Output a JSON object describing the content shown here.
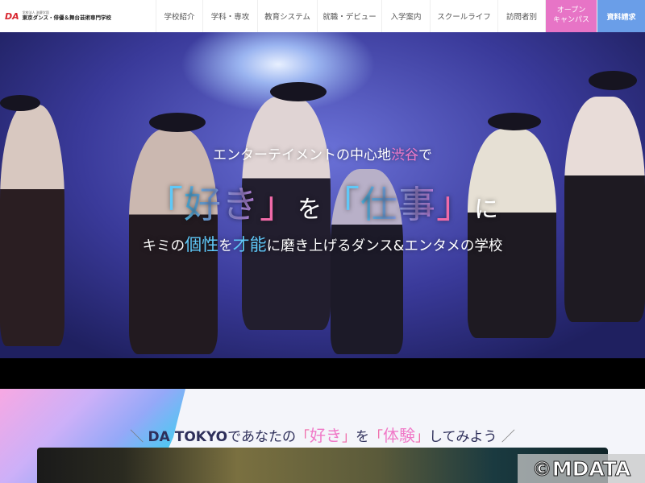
{
  "header": {
    "logo": {
      "mark": "DA",
      "small": "学校法人 滋慶学園",
      "name": "東京ダンス・俳優＆舞台芸術専門学校"
    },
    "nav": [
      "学校紹介",
      "学科・専攻",
      "教育システム",
      "就職・デビュー",
      "入学案内",
      "スクールライフ",
      "訪問者別"
    ],
    "open_campus": [
      "オープン",
      "キャンパス"
    ],
    "request": "資料請求"
  },
  "hero": {
    "line1_a": "エンターテイメントの中心地",
    "line1_b": "渋谷",
    "line1_c": "で",
    "line2": {
      "o1": "「",
      "w1": "好き",
      "c1": "」",
      "m": "を",
      "o2": "「",
      "w2": "仕事",
      "c2": "」",
      "e": "に"
    },
    "line3": {
      "a": "キミの",
      "b": "個性",
      "c": "を",
      "d": "才能",
      "e": "に磨き上げるダンス&エンタメの学校"
    }
  },
  "section": {
    "pre": "＼ ",
    "brand": "DA TOKYO",
    "a": "であなたの",
    "o1": "「",
    "w1": "好き",
    "c1": "」",
    "b": "を",
    "o2": "「",
    "w2": "体験",
    "c2": "」",
    "c": "してみよう",
    "post": " ／"
  },
  "watermark": "©MDATA"
}
